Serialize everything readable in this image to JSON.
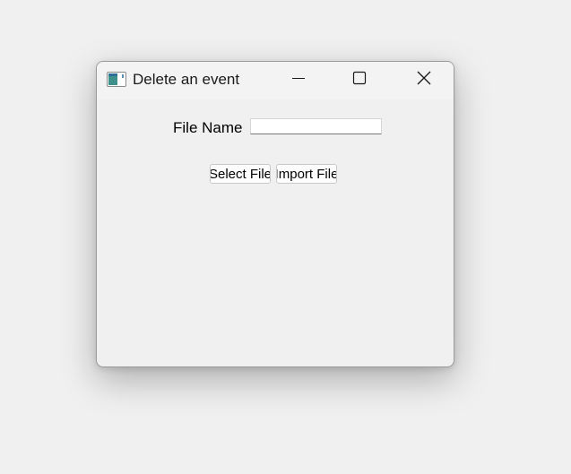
{
  "window": {
    "title": "Delete an event",
    "icon": "app-window-icon",
    "controls": {
      "minimize": "minimize-icon",
      "maximize": "maximize-icon",
      "close": "close-icon"
    }
  },
  "form": {
    "file_name_label": "File Name",
    "file_name_value": "",
    "select_button_label": "Select File",
    "import_button_label": "Import File"
  },
  "colors": {
    "background": "#f0f0f0",
    "window_border": "#9a9a9a",
    "button_border": "#c9c9c9"
  }
}
